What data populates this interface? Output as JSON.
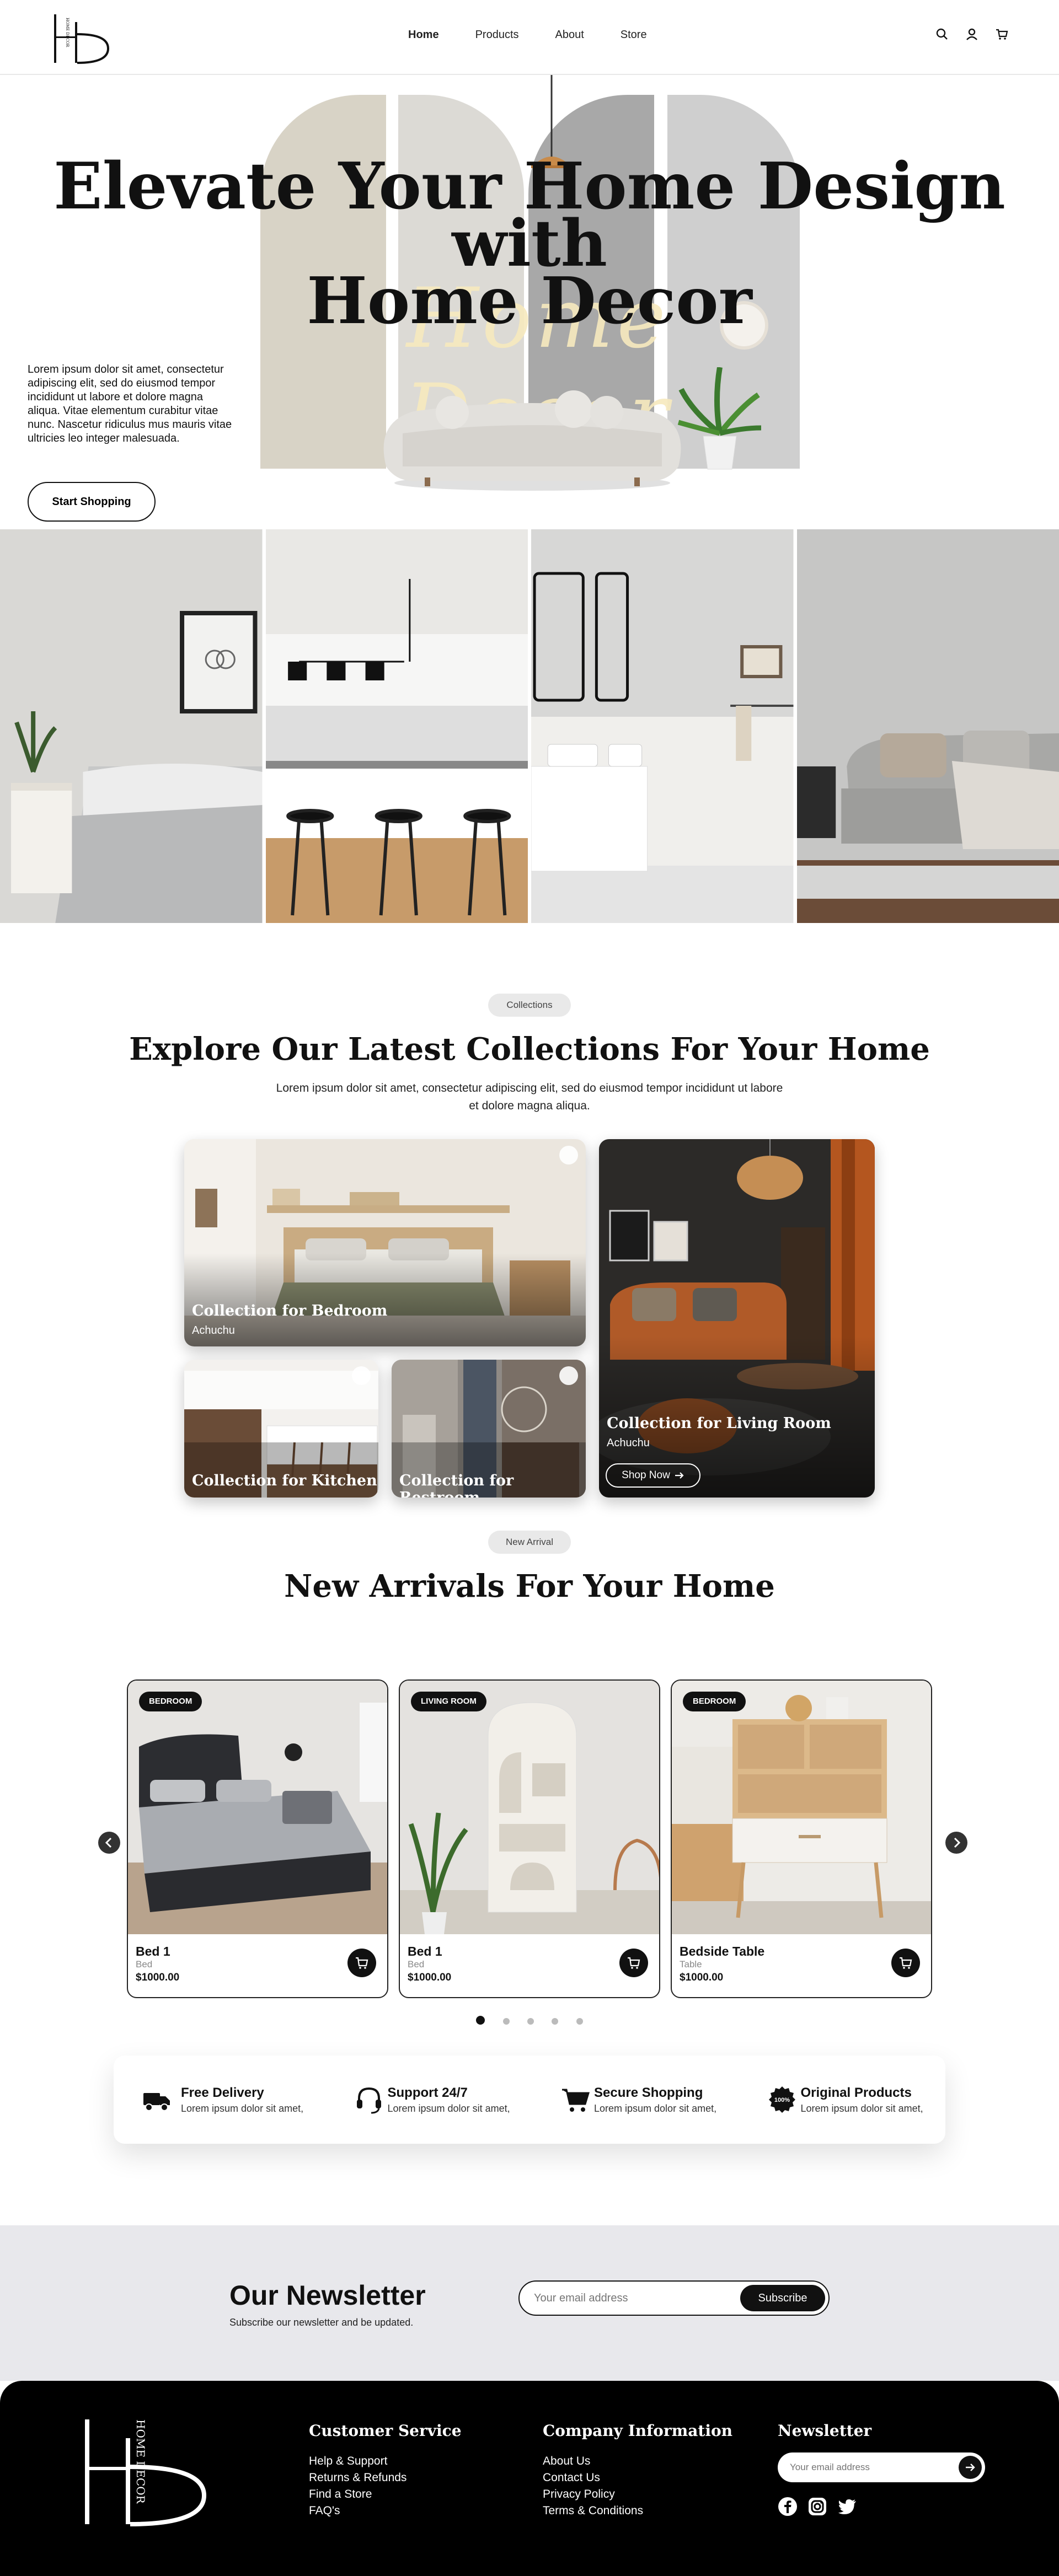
{
  "nav": {
    "links": [
      "Home",
      "Products",
      "About",
      "Store"
    ],
    "icons": [
      "search-icon",
      "user-icon",
      "cart-icon"
    ],
    "logo_text": "HOME DECOR"
  },
  "hero": {
    "title_line1": "Elevate Your Home Design with",
    "title_line2": "Home Decor",
    "script_text": "Home Decor",
    "text": "Lorem ipsum dolor sit amet, consectetur adipiscing elit, sed do eiusmod tempor incididunt ut labore et dolore magna aliqua. Vitae elementum curabitur vitae nunc. Nascetur ridiculus mus mauris vitae ultricies leo integer malesuada.",
    "cta": "Start Shopping"
  },
  "collections": {
    "pill": "Collections",
    "title": "Explore Our Latest Collections For Your Home",
    "subtitle": "Lorem ipsum dolor sit amet, consectetur adipiscing elit, sed do eiusmod tempor incididunt ut labore et dolore magna aliqua.",
    "bedroom": {
      "title": "Collection for Bedroom",
      "sub": "Achuchu"
    },
    "kitchen": {
      "title": "Collection for Kitchen"
    },
    "restroom": {
      "title": "Collection for Restroom"
    },
    "living": {
      "title": "Collection for Living Room",
      "sub": "Achuchu",
      "cta": "Shop Now"
    }
  },
  "arrivals": {
    "pill": "New Arrival",
    "title": "New Arrivals For Your Home",
    "products": [
      {
        "badge": "BEDROOM",
        "name": "Bed 1",
        "category": "Bed",
        "price": "$1000.00"
      },
      {
        "badge": "LIVING ROOM",
        "name": "Bed 1",
        "category": "Bed",
        "price": "$1000.00"
      },
      {
        "badge": "BEDROOM",
        "name": "Bedside Table",
        "category": "Table",
        "price": "$1000.00"
      }
    ],
    "dots_total": 5,
    "dots_active": 1
  },
  "features": [
    {
      "icon": "truck-icon",
      "title": "Free Delivery",
      "desc": "Lorem ipsum dolor sit amet,"
    },
    {
      "icon": "headset-icon",
      "title": "Support 24/7",
      "desc": "Lorem ipsum dolor sit amet,"
    },
    {
      "icon": "shopping-cart-icon",
      "title": "Secure Shopping",
      "desc": "Lorem ipsum dolor sit amet,"
    },
    {
      "icon": "badge-100-icon",
      "title": "Original Products",
      "desc": "Lorem ipsum dolor sit amet,"
    }
  ],
  "newsletter": {
    "title": "Our Newsletter",
    "subtitle": "Subscribe our newsletter and be updated.",
    "placeholder": "Your email address",
    "button": "Subscribe"
  },
  "footer": {
    "logo_text": "HOME DECOR",
    "customer_service": {
      "title": "Customer Service",
      "links": [
        "Help & Support",
        "Returns & Refunds",
        "Find a Store",
        "FAQ's"
      ]
    },
    "company": {
      "title": "Company Information",
      "links": [
        "About Us",
        "Contact Us",
        "Privacy Policy",
        "Terms & Conditions"
      ]
    },
    "newsletter": {
      "title": "Newsletter",
      "placeholder": "Your email address"
    },
    "socials": [
      "facebook-icon",
      "instagram-icon",
      "twitter-icon"
    ]
  }
}
